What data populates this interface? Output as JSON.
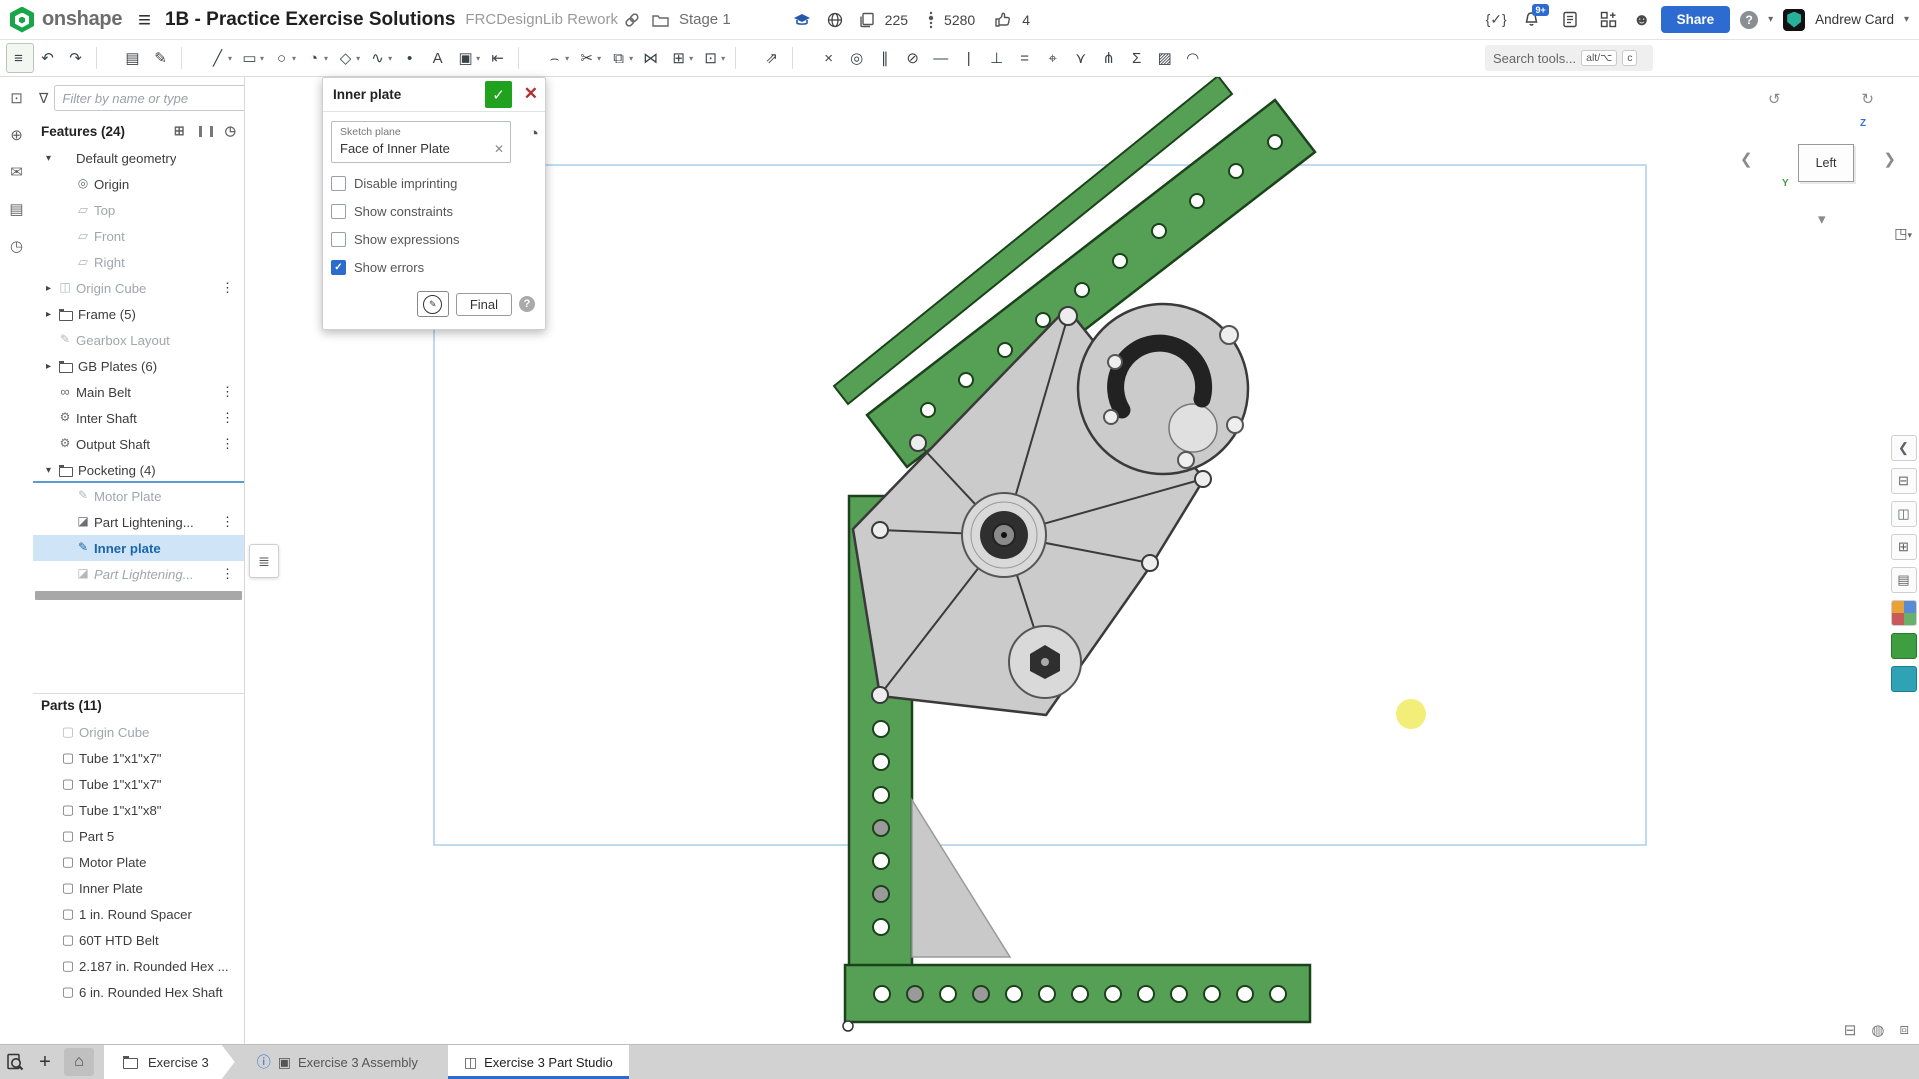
{
  "header": {
    "logo_text": "onshape",
    "title": "1B - Practice Exercise Solutions",
    "subtitle": "FRCDesignLib Rework",
    "breadcrumb": "Stage 1",
    "stat_copies": "225",
    "stat_follows": "5280",
    "stat_likes": "4",
    "notification_badge": "9+",
    "curly_check": "{✓}",
    "share_label": "Share",
    "help_glyph": "?",
    "user_name": "Andrew Card",
    "accent_blue": "#2d6bd0"
  },
  "toolbar": {
    "search_placeholder": "Search tools...",
    "kbd1": "alt/⌥",
    "kbd2": "c",
    "icons": [
      {
        "name": "sketch-list-button",
        "glyph": "≡",
        "state": "active"
      },
      {
        "name": "undo-icon",
        "glyph": "↶"
      },
      {
        "name": "redo-icon",
        "glyph": "↷"
      },
      {
        "state": "sep"
      },
      {
        "name": "insert-image-icon",
        "glyph": "▤"
      },
      {
        "name": "sketch-face-icon",
        "glyph": "✎"
      },
      {
        "state": "sep"
      },
      {
        "name": "line-tool",
        "glyph": "╱",
        "caret": "▾"
      },
      {
        "name": "rectangle-tool",
        "glyph": "▭",
        "caret": "▾"
      },
      {
        "name": "circle-tool",
        "glyph": "○",
        "caret": "▾"
      },
      {
        "name": "arc-circle-tool",
        "glyph": "◔",
        "caret": "▾"
      },
      {
        "name": "polygon-tool",
        "glyph": "◇",
        "caret": "▾"
      },
      {
        "name": "spline-tool",
        "glyph": "∿",
        "caret": "▾"
      },
      {
        "name": "point-tool",
        "glyph": "•"
      },
      {
        "name": "text-tool",
        "glyph": "A"
      },
      {
        "name": "image-tool",
        "glyph": "▣",
        "caret": "▾"
      },
      {
        "name": "offset-tool",
        "glyph": "⇤"
      },
      {
        "state": "sep"
      },
      {
        "name": "fillet-tool",
        "glyph": "⌢",
        "caret": "▾"
      },
      {
        "name": "trim-tool",
        "glyph": "✂",
        "caret": "▾"
      },
      {
        "name": "transform-tool",
        "glyph": "⧉",
        "caret": "▾"
      },
      {
        "name": "mirror-tool",
        "glyph": "⋈"
      },
      {
        "name": "pattern-tool",
        "glyph": "⊞",
        "caret": "▾"
      },
      {
        "name": "export-dxf-tool",
        "glyph": "⊡",
        "caret": "▾"
      },
      {
        "state": "sep"
      },
      {
        "name": "measure-tool",
        "glyph": "⇗"
      },
      {
        "state": "sep"
      },
      {
        "name": "coincident-constraint",
        "glyph": "×"
      },
      {
        "name": "concentric-constraint",
        "glyph": "◎"
      },
      {
        "name": "parallel-constraint",
        "glyph": "∥"
      },
      {
        "name": "tangent-constraint",
        "glyph": "⊘"
      },
      {
        "name": "horizontal-constraint",
        "glyph": "—"
      },
      {
        "name": "vertical-constraint",
        "glyph": "|"
      },
      {
        "name": "perpendicular-constraint",
        "glyph": "⊥"
      },
      {
        "name": "equal-constraint",
        "glyph": "="
      },
      {
        "name": "midpoint-constraint",
        "glyph": "⌖"
      },
      {
        "name": "pierce-constraint",
        "glyph": "⋎"
      },
      {
        "name": "symmetry-constraint",
        "glyph": "⋔"
      },
      {
        "name": "sketch-pattern-icon",
        "glyph": "Σ"
      },
      {
        "name": "crosshatch-icon",
        "glyph": "▨"
      },
      {
        "name": "fan-icon",
        "glyph": "◠"
      }
    ]
  },
  "left_dock": {
    "icons": [
      {
        "name": "frame-icon",
        "glyph": "⊡"
      },
      {
        "name": "insert-icon",
        "glyph": "⊕"
      },
      {
        "name": "comments-icon",
        "glyph": "✉"
      },
      {
        "name": "notes-icon",
        "glyph": "▤"
      },
      {
        "name": "history-icon",
        "glyph": "◷"
      }
    ]
  },
  "features_panel": {
    "filter_placeholder": "Filter by name or type",
    "header": "Features (24)",
    "tree": [
      {
        "name": "tree-item-default-geometry",
        "caret": "▾",
        "label": "Default geometry",
        "depth": 0
      },
      {
        "name": "tree-item-origin",
        "icon": "origin",
        "label": "Origin",
        "depth": 1
      },
      {
        "name": "tree-item-top",
        "icon": "plane",
        "label": "Top",
        "depth": 1,
        "state": "muted"
      },
      {
        "name": "tree-item-front",
        "icon": "plane",
        "label": "Front",
        "depth": 1,
        "state": "muted"
      },
      {
        "name": "tree-item-right",
        "icon": "plane",
        "label": "Right",
        "depth": 1,
        "state": "muted"
      },
      {
        "name": "tree-item-origin-cube",
        "caret": "▸",
        "icon": "cube",
        "label": "Origin Cube",
        "depth": 0,
        "state": "muted",
        "dots": "⋮"
      },
      {
        "name": "tree-item-frame",
        "caret": "▸",
        "icon": "folder",
        "label": "Frame (5)",
        "depth": 0
      },
      {
        "name": "tree-item-gearbox-layout",
        "icon": "sketch",
        "label": "Gearbox Layout",
        "depth": 0,
        "state": "muted"
      },
      {
        "name": "tree-item-gb-plates",
        "caret": "▸",
        "icon": "folder",
        "label": "GB Plates (6)",
        "depth": 0
      },
      {
        "name": "tree-item-main-belt",
        "icon": "belt",
        "label": "Main Belt",
        "depth": 0,
        "dots": "⋮"
      },
      {
        "name": "tree-item-inter-shaft",
        "icon": "shaft",
        "label": "Inter Shaft",
        "depth": 0,
        "dots": "⋮"
      },
      {
        "name": "tree-item-output-shaft",
        "icon": "shaft",
        "label": "Output Shaft",
        "depth": 0,
        "dots": "⋮"
      },
      {
        "name": "tree-item-pocketing",
        "caret": "▾",
        "icon": "folder",
        "label": "Pocketing (4)",
        "depth": 0,
        "state": "insert"
      },
      {
        "name": "tree-item-motor-plate",
        "icon": "sketch",
        "label": "Motor Plate",
        "depth": 1,
        "state": "muted"
      },
      {
        "name": "tree-item-part-lightening-1",
        "icon": "extrude",
        "label": "Part Lightening...",
        "depth": 1,
        "dots": "⋮"
      },
      {
        "name": "tree-item-inner-plate",
        "icon": "sketch",
        "label": "Inner plate",
        "depth": 1,
        "state": "selected"
      },
      {
        "name": "tree-item-part-lightening-2",
        "icon": "extrude",
        "label": "Part Lightening...",
        "depth": 1,
        "state": "muted italic",
        "dots": "⋮"
      }
    ],
    "parts_header": "Parts (11)",
    "parts": [
      {
        "name": "part-origin-cube",
        "icon": "part",
        "label": "Origin Cube",
        "state": "muted"
      },
      {
        "name": "part-tube-7a",
        "icon": "part",
        "label": "Tube 1\"x1\"x7\""
      },
      {
        "name": "part-tube-7b",
        "icon": "part",
        "label": "Tube 1\"x1\"x7\""
      },
      {
        "name": "part-tube-8",
        "icon": "part",
        "label": "Tube 1\"x1\"x8\""
      },
      {
        "name": "part-part5",
        "icon": "part",
        "label": "Part 5"
      },
      {
        "name": "part-motor-plate",
        "icon": "part",
        "label": "Motor Plate"
      },
      {
        "name": "part-inner-plate",
        "icon": "part",
        "label": "Inner Plate"
      },
      {
        "name": "part-round-spacer",
        "icon": "part",
        "label": "1 in. Round Spacer"
      },
      {
        "name": "part-htd-belt",
        "icon": "part",
        "label": "60T HTD Belt"
      },
      {
        "name": "part-hex-2187",
        "icon": "part",
        "label": "2.187 in. Rounded Hex ..."
      },
      {
        "name": "part-hex-6in",
        "icon": "part",
        "label": "6 in. Rounded Hex Shaft"
      }
    ]
  },
  "dialog": {
    "title": "Inner plate",
    "ok_glyph": "✓",
    "close_glyph": "✕",
    "field_label": "Sketch plane",
    "field_value": "Face of Inner Plate",
    "clear_glyph": "✕",
    "clock_glyph": "◔",
    "checkboxes": [
      {
        "name": "checkbox-disable-imprinting",
        "label": "Disable imprinting",
        "checked": false
      },
      {
        "name": "checkbox-show-constraints",
        "label": "Show constraints",
        "checked": false
      },
      {
        "name": "checkbox-show-expressions",
        "label": "Show expressions",
        "checked": false
      },
      {
        "name": "checkbox-show-errors",
        "label": "Show errors",
        "checked": true
      }
    ],
    "final_label": "Final",
    "help_glyph": "?"
  },
  "view_cube": {
    "face_label": "Left",
    "axis_y": "Y",
    "axis_z": "Z",
    "rotate_left": "↺",
    "rotate_right": "↻",
    "chev_left": "❮",
    "chev_right": "❯",
    "chev_down": "▾",
    "cube_glyph": "◳"
  },
  "right_col": {
    "icons": [
      {
        "name": "collapse-handle",
        "glyph": "❮"
      },
      {
        "name": "display-options-icon",
        "glyph": "⊟"
      },
      {
        "name": "section-view-icon",
        "glyph": "◫"
      },
      {
        "name": "named-views-icon",
        "glyph": "⊞"
      },
      {
        "name": "view-settings-icon",
        "glyph": "▤"
      },
      {
        "name": "palette-icon",
        "icon": "multicolor",
        "glyph": ""
      },
      {
        "name": "parts-color-icon",
        "icon": "green-tile",
        "glyph": ""
      },
      {
        "name": "layers-icon",
        "icon": "teal-tile",
        "glyph": ""
      }
    ]
  },
  "canvas_hud": {
    "icons": [
      {
        "name": "snapshot-icon",
        "glyph": "⊟"
      },
      {
        "name": "turntable-icon",
        "glyph": "◍"
      },
      {
        "name": "hud-layers-icon",
        "glyph": "⧈"
      }
    ]
  },
  "bottom_bar": {
    "plus_glyph": "+",
    "home_glyph": "⌂",
    "tabs": [
      {
        "name": "tab-exercise-3",
        "label": "Exercise 3",
        "icon": "folder",
        "state": "chev",
        "info": ""
      },
      {
        "name": "tab-exercise-3-assembly",
        "label": "Exercise 3 Assembly",
        "icon": "assembly",
        "info": "ⓘ"
      },
      {
        "name": "tab-exercise-3-part-studio",
        "label": "Exercise 3 Part Studio",
        "icon": "partstudio",
        "state": "active",
        "info": ""
      }
    ]
  },
  "canvas": {
    "colors": {
      "tube": "#55a055",
      "tube-dark": "#1c421c",
      "plate": "#cbcbcb",
      "plate-dark": "#3a3a3a",
      "yellow": "#f3ee79",
      "sketch": "#abcfe9"
    }
  }
}
